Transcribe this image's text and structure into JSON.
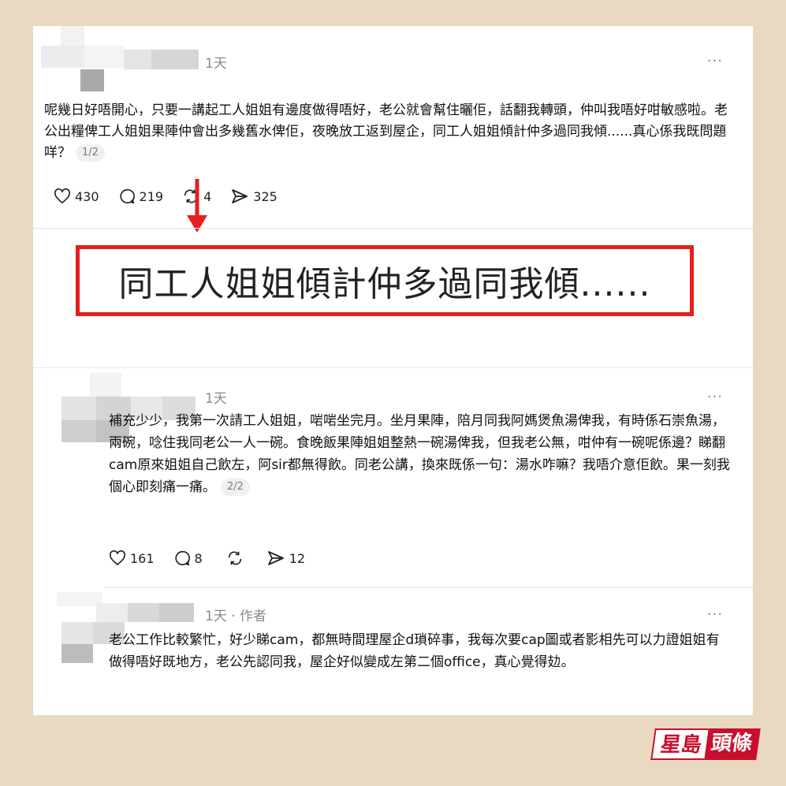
{
  "posts": [
    {
      "time": "1天",
      "more": "···",
      "text": "呢幾日好唔開心，只要一講起工人姐姐有邊度做得唔好，老公就會幫住曬佢，話翻我轉頭，仲叫我唔好咁敏感啦。老公出糧俾工人姐姐果陣仲會出多幾舊水俾佢，夜晚放工返到屋企，同工人姐姐傾計仲多過同我傾......真心係我既問題咩？",
      "page": "1/2",
      "likes": "430",
      "comments": "219",
      "reposts": "4",
      "shares": "325"
    },
    {
      "time": "1天",
      "more": "···",
      "text": "補充少少，我第一次請工人姐姐，啱啱坐完月。坐月果陣，陪月同我阿媽煲魚湯俾我，有時係石崇魚湯，兩碗，唸住我同老公一人一碗。食晚飯果陣姐姐整熱一碗湯俾我，但我老公無，咁仲有一碗呢係邊？睇翻cam原來姐姐自己飲左，阿sir都無得飲。同老公講，換來既係一句：湯水咋嘛？我唔介意佢飲。果一刻我個心即刻痛一痛。",
      "page": "2/2",
      "likes": "161",
      "comments": "8",
      "shares": "12"
    },
    {
      "time": "1天 · 作者",
      "more": "···",
      "text": "老公工作比較繁忙，好少睇cam，都無時間理屋企d瑣碎事，我每次要cap圖或者影相先可以力證姐姐有做得唔好既地方，老公先認同我，屋企好似變成左第二個office，真心覺得攰。"
    }
  ],
  "highlight": "同工人姐姐傾計仲多過同我傾......",
  "logo": {
    "part1": "星島",
    "part2": "頭條"
  },
  "colors": {
    "accent_red": "#e61e1e",
    "brand_red": "#c8102e",
    "background": "#e8d9c0"
  },
  "icons": [
    "heart-icon",
    "comment-icon",
    "repost-icon",
    "share-icon",
    "more-icon",
    "arrow-down-icon"
  ]
}
